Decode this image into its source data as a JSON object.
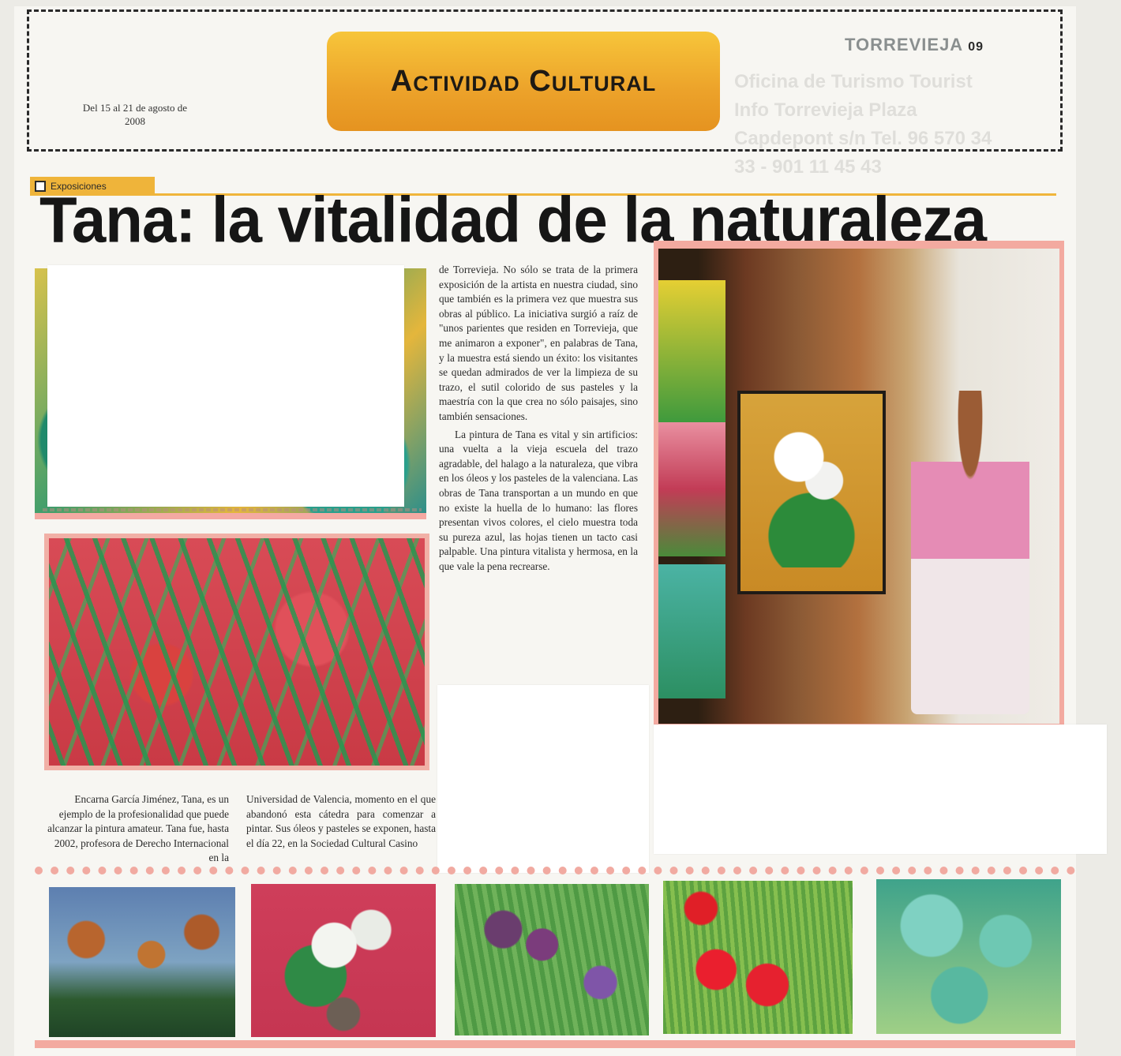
{
  "header": {
    "section_banner": "Actividad Cultural",
    "date_range": "Del 15 al 21 de agosto de 2008",
    "publication": "TORREVIEJA",
    "page_number": "09",
    "ghost_text": "Oficina de Turismo Tourist Info Torrevieja Plaza Capdepont s/n Tel. 96 570 34 33 - 901 11 45 43"
  },
  "article": {
    "category": "Exposiciones",
    "headline": "Tana: la vitalidad de la naturaleza",
    "body_middle": [
      "de Torrevieja. No sólo se trata de la primera exposición de la artista en nuestra ciudad, sino que también es la primera vez que muestra sus obras al público. La iniciativa surgió a raíz de \"unos parientes que residen en Torrevieja, que me animaron a exponer\", en palabras de Tana, y la muestra está siendo un éxito: los visitantes se quedan admirados de ver la limpieza de su trazo, el sutil colorido de sus pasteles y la maestría con la que crea no sólo paisajes, sino también sensaciones.",
      "La pintura de Tana es vital y sin artificios: una vuelta a la vieja escuela del trazo agradable, del halago a la naturaleza, que vibra en los óleos y los pasteles de la valenciana. Las obras de Tana transportan a un mundo en que no existe la huella de lo humano: las flores presentan vivos colores, el cielo muestra toda su pureza azul, las hojas tienen un tacto casi palpable. Una pintura vitalista y hermosa, en la que vale la pena recrearse."
    ],
    "body_bottom_left": "Encarna García Jiménez, Tana, es un ejemplo de la profesionalidad que puede alcanzar la pintura amateur. Tana fue, hasta 2002, profesora de Derecho Internacional en la",
    "body_bottom_middle": "Universidad de Valencia, momento en el que abandonó esta cátedra para comenzar a pintar. Sus óleos y pasteles se exponen, hasta el día 22, en la Sociedad Cultural Casino"
  },
  "images": {
    "top_left": "painting-landscape",
    "middle_left": "painting-red-flowers-green-leaves",
    "photo": "artist-with-calla-lily-painting",
    "thumbnails": [
      "sunflowers",
      "calla-lilies",
      "purple-irises",
      "red-poppies",
      "turquoise-leaves"
    ]
  },
  "colors": {
    "banner_orange": "#eca22a",
    "accent_pink": "#f3aaa0",
    "headline": "#161616"
  }
}
